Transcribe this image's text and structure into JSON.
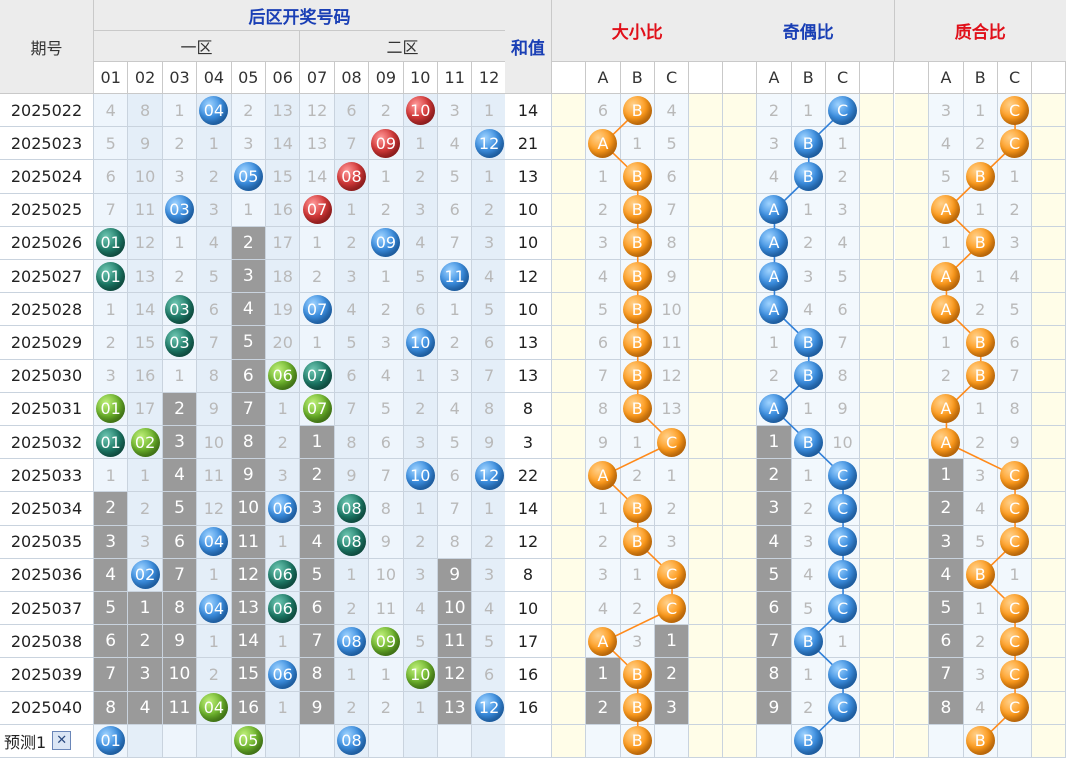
{
  "header": {
    "period_label": "期号",
    "back_title": "后区开奖号码",
    "zone1": "一区",
    "zone2": "二区",
    "sum_label": "和值",
    "size_title": "大小比",
    "parity_title": "奇偶比",
    "prime_title": "质合比",
    "numbers": [
      "01",
      "02",
      "03",
      "04",
      "05",
      "06",
      "07",
      "08",
      "09",
      "10",
      "11",
      "12"
    ],
    "abc": [
      "A",
      "B",
      "C"
    ]
  },
  "colors": {
    "blue": "#3d8fe0",
    "red": "#d43a3a",
    "dark_green": "#1d7a67",
    "light_green": "#6ab02a",
    "orange": "#ff9a1a"
  },
  "chart_data": {
    "type": "table",
    "rows": [
      {
        "period": "2025022",
        "cells": [
          "4",
          "8",
          "1",
          "04",
          "2",
          "13",
          "12",
          "6",
          "2",
          "10",
          "3",
          "1"
        ],
        "sum": "14",
        "size": [
          "6",
          "B",
          "4"
        ],
        "parity": [
          "2",
          "1",
          "C"
        ],
        "prime": [
          "3",
          "1",
          "C"
        ]
      },
      {
        "period": "2025023",
        "cells": [
          "5",
          "9",
          "2",
          "1",
          "3",
          "14",
          "13",
          "7",
          "09",
          "1",
          "4",
          "12"
        ],
        "sum": "21",
        "size": [
          "A",
          "1",
          "5"
        ],
        "parity": [
          "3",
          "B",
          "1"
        ],
        "prime": [
          "4",
          "2",
          "C"
        ]
      },
      {
        "period": "2025024",
        "cells": [
          "6",
          "10",
          "3",
          "2",
          "05",
          "15",
          "14",
          "08",
          "1",
          "2",
          "5",
          "1"
        ],
        "sum": "13",
        "size": [
          "1",
          "B",
          "6"
        ],
        "parity": [
          "4",
          "B",
          "2"
        ],
        "prime": [
          "5",
          "B",
          "1"
        ]
      },
      {
        "period": "2025025",
        "cells": [
          "7",
          "11",
          "03",
          "3",
          "1",
          "16",
          "07",
          "1",
          "2",
          "3",
          "6",
          "2"
        ],
        "sum": "10",
        "size": [
          "2",
          "B",
          "7"
        ],
        "parity": [
          "A",
          "1",
          "3"
        ],
        "prime": [
          "A",
          "1",
          "2"
        ]
      },
      {
        "period": "2025026",
        "cells": [
          "01",
          "12",
          "1",
          "4",
          "2",
          "17",
          "1",
          "2",
          "09",
          "4",
          "7",
          "3"
        ],
        "sum": "10",
        "size": [
          "3",
          "B",
          "8"
        ],
        "parity": [
          "A",
          "2",
          "4"
        ],
        "prime": [
          "1",
          "B",
          "3"
        ]
      },
      {
        "period": "2025027",
        "cells": [
          "01",
          "13",
          "2",
          "5",
          "3",
          "18",
          "2",
          "3",
          "1",
          "5",
          "11",
          "4"
        ],
        "sum": "12",
        "size": [
          "4",
          "B",
          "9"
        ],
        "parity": [
          "A",
          "3",
          "5"
        ],
        "prime": [
          "A",
          "1",
          "4"
        ]
      },
      {
        "period": "2025028",
        "cells": [
          "1",
          "14",
          "03",
          "6",
          "4",
          "19",
          "07",
          "4",
          "2",
          "6",
          "1",
          "5"
        ],
        "sum": "10",
        "size": [
          "5",
          "B",
          "10"
        ],
        "parity": [
          "A",
          "4",
          "6"
        ],
        "prime": [
          "A",
          "2",
          "5"
        ]
      },
      {
        "period": "2025029",
        "cells": [
          "2",
          "15",
          "03",
          "7",
          "5",
          "20",
          "1",
          "5",
          "3",
          "10",
          "2",
          "6"
        ],
        "sum": "13",
        "size": [
          "6",
          "B",
          "11"
        ],
        "parity": [
          "1",
          "B",
          "7"
        ],
        "prime": [
          "1",
          "B",
          "6"
        ]
      },
      {
        "period": "2025030",
        "cells": [
          "3",
          "16",
          "1",
          "8",
          "6",
          "06",
          "07",
          "6",
          "4",
          "1",
          "3",
          "7"
        ],
        "sum": "13",
        "size": [
          "7",
          "B",
          "12"
        ],
        "parity": [
          "2",
          "B",
          "8"
        ],
        "prime": [
          "2",
          "B",
          "7"
        ]
      },
      {
        "period": "2025031",
        "cells": [
          "01",
          "17",
          "2",
          "9",
          "7",
          "1",
          "07",
          "7",
          "5",
          "2",
          "4",
          "8"
        ],
        "sum": "8",
        "size": [
          "8",
          "B",
          "13"
        ],
        "parity": [
          "A",
          "1",
          "9"
        ],
        "prime": [
          "A",
          "1",
          "8"
        ]
      },
      {
        "period": "2025032",
        "cells": [
          "01",
          "02",
          "3",
          "10",
          "8",
          "2",
          "1",
          "8",
          "6",
          "3",
          "5",
          "9"
        ],
        "sum": "3",
        "size": [
          "9",
          "1",
          "C"
        ],
        "parity": [
          "1",
          "B",
          "10"
        ],
        "prime": [
          "A",
          "2",
          "9"
        ]
      },
      {
        "period": "2025033",
        "cells": [
          "1",
          "1",
          "4",
          "11",
          "9",
          "3",
          "2",
          "9",
          "7",
          "10",
          "6",
          "12"
        ],
        "sum": "22",
        "size": [
          "A",
          "2",
          "1"
        ],
        "parity": [
          "2",
          "1",
          "C"
        ],
        "prime": [
          "1",
          "3",
          "C"
        ]
      },
      {
        "period": "2025034",
        "cells": [
          "2",
          "2",
          "5",
          "12",
          "10",
          "06",
          "3",
          "08",
          "8",
          "1",
          "7",
          "1"
        ],
        "sum": "14",
        "size": [
          "1",
          "B",
          "2"
        ],
        "parity": [
          "3",
          "2",
          "C"
        ],
        "prime": [
          "2",
          "4",
          "C"
        ]
      },
      {
        "period": "2025035",
        "cells": [
          "3",
          "3",
          "6",
          "04",
          "11",
          "1",
          "4",
          "08",
          "9",
          "2",
          "8",
          "2"
        ],
        "sum": "12",
        "size": [
          "2",
          "B",
          "3"
        ],
        "parity": [
          "4",
          "3",
          "C"
        ],
        "prime": [
          "3",
          "5",
          "C"
        ]
      },
      {
        "period": "2025036",
        "cells": [
          "4",
          "02",
          "7",
          "1",
          "12",
          "06",
          "5",
          "1",
          "10",
          "3",
          "9",
          "3"
        ],
        "sum": "8",
        "size": [
          "3",
          "1",
          "C"
        ],
        "parity": [
          "5",
          "4",
          "C"
        ],
        "prime": [
          "4",
          "B",
          "1"
        ]
      },
      {
        "period": "2025037",
        "cells": [
          "5",
          "1",
          "8",
          "04",
          "13",
          "06",
          "6",
          "2",
          "11",
          "4",
          "10",
          "4"
        ],
        "sum": "10",
        "size": [
          "4",
          "2",
          "C"
        ],
        "parity": [
          "6",
          "5",
          "C"
        ],
        "prime": [
          "5",
          "1",
          "C"
        ]
      },
      {
        "period": "2025038",
        "cells": [
          "6",
          "2",
          "9",
          "1",
          "14",
          "1",
          "7",
          "08",
          "09",
          "5",
          "11",
          "5"
        ],
        "sum": "17",
        "size": [
          "A",
          "3",
          "1"
        ],
        "parity": [
          "7",
          "B",
          "1"
        ],
        "prime": [
          "6",
          "2",
          "C"
        ]
      },
      {
        "period": "2025039",
        "cells": [
          "7",
          "3",
          "10",
          "2",
          "15",
          "06",
          "8",
          "1",
          "1",
          "10",
          "12",
          "6"
        ],
        "sum": "16",
        "size": [
          "1",
          "B",
          "2"
        ],
        "parity": [
          "8",
          "1",
          "C"
        ],
        "prime": [
          "7",
          "3",
          "C"
        ]
      },
      {
        "period": "2025040",
        "cells": [
          "8",
          "4",
          "11",
          "04",
          "16",
          "1",
          "9",
          "2",
          "2",
          "1",
          "13",
          "12"
        ],
        "sum": "16",
        "size": [
          "2",
          "B",
          "3"
        ],
        "parity": [
          "9",
          "2",
          "C"
        ],
        "prime": [
          "8",
          "4",
          "C"
        ]
      }
    ],
    "ball_colors": {
      "2025022": {
        "4": "blue",
        "10": "red"
      },
      "2025023": {
        "9": "red",
        "12": "blue"
      },
      "2025024": {
        "5": "blue",
        "8": "red"
      },
      "2025025": {
        "3": "blue",
        "7": "red"
      },
      "2025026": {
        "1": "dgreen",
        "9": "blue"
      },
      "2025027": {
        "1": "dgreen",
        "11": "blue"
      },
      "2025028": {
        "3": "dgreen",
        "7": "blue"
      },
      "2025029": {
        "3": "dgreen",
        "10": "blue"
      },
      "2025030": {
        "6": "lgreen",
        "7": "dgreen"
      },
      "2025031": {
        "1": "lgreen",
        "7": "lgreen"
      },
      "2025032": {
        "1": "dgreen",
        "2": "lgreen"
      },
      "2025033": {
        "10": "blue",
        "12": "blue"
      },
      "2025034": {
        "6": "blue",
        "8": "dgreen"
      },
      "2025035": {
        "4": "blue",
        "8": "dgreen"
      },
      "2025036": {
        "2": "blue",
        "6": "dgreen"
      },
      "2025037": {
        "4": "blue",
        "6": "dgreen"
      },
      "2025038": {
        "8": "blue",
        "9": "lgreen"
      },
      "2025039": {
        "6": "blue",
        "10": "lgreen"
      },
      "2025040": {
        "4": "lgreen",
        "12": "blue"
      }
    },
    "forecast": {
      "label": "预测1",
      "close": "✕",
      "balls": {
        "1": "01",
        "5": "05",
        "8": "08"
      },
      "ball_colors": {
        "1": "blue",
        "5": "lgreen",
        "8": "blue"
      },
      "size": "B",
      "parity": "B",
      "prime": "B"
    }
  }
}
